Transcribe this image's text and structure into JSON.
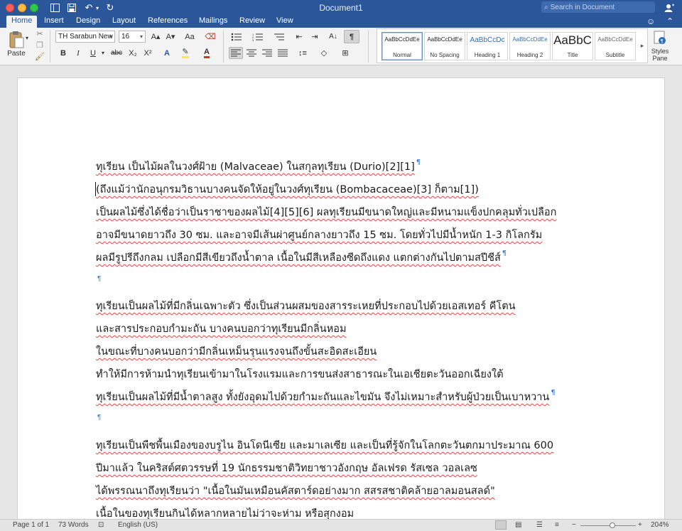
{
  "window": {
    "title": "Document1",
    "search_placeholder": "Search in Document"
  },
  "quick_access": {
    "sidebar_icon": "sidebar-icon",
    "save_icon": "save-icon",
    "undo_icon": "undo-icon",
    "redo_icon": "redo-icon",
    "undo_glyph": "↶",
    "redo_glyph": "↻"
  },
  "tabs": [
    "Home",
    "Insert",
    "Design",
    "Layout",
    "References",
    "Mailings",
    "Review",
    "View"
  ],
  "active_tab": "Home",
  "ribbon": {
    "paste_label": "Paste",
    "font_name": "TH Sarabun New",
    "font_size": "16",
    "grow_font": "A▴",
    "shrink_font": "A▾",
    "change_case": "Aa",
    "bold": "B",
    "italic": "I",
    "underline": "U",
    "strikethrough": "abc",
    "subscript": "X₂",
    "superscript": "X²",
    "text_effects": "A",
    "font_color": "A",
    "show_marks": "¶",
    "styles": [
      {
        "preview": "AaBbCcDdEe",
        "name": "Normal"
      },
      {
        "preview": "AaBbCcDdEe",
        "name": "No Spacing"
      },
      {
        "preview": "AaBbCcDc",
        "name": "Heading 1"
      },
      {
        "preview": "AaBbCcDdEe",
        "name": "Heading 2"
      },
      {
        "preview": "AaBbC",
        "name": "Title"
      },
      {
        "preview": "AaBbCcDdEe",
        "name": "Subtitle"
      }
    ],
    "styles_pane": "Styles\nPane",
    "styles_pane_line1": "Styles",
    "styles_pane_line2": "Pane"
  },
  "colors": {
    "brand_blue": "#2b579a",
    "spell_underline": "#e0483e",
    "pilcrow": "#3a7bd5",
    "highlight": "#ffeb3b",
    "font_color_bar": "#d93025"
  },
  "document": {
    "lines": [
      {
        "text": "ทุเรียน เป็นไม้ผลในวงศ์ฝ้าย (Malvaceae) ในสกุลทุเรียน (Durio)[2][1]",
        "mark": true
      },
      {
        "text": "(ถึงแม้ว่านักอนุกรมวิธานบางคนจัดให้อยู่ในวงศ์ทุเรียน (Bombacaceae)[3] ก็ตาม[1])",
        "mark": false
      },
      {
        "text": "เป็นผลไม้ซึ่งได้ชื่อว่าเป็นราชาของผลไม้[4][5][6] ผลทุเรียนมีขนาดใหญ่และมีหนามแข็งปกคลุมทั่วเปลือก",
        "mark": false
      },
      {
        "text": "อาจมีขนาดยาวถึง 30 ซม. และอาจมีเส้นผ่าศูนย์กลางยาวถึง 15 ซม. โดยทั่วไปมีน้ำหนัก 1-3 กิโลกรัม",
        "mark": false
      },
      {
        "text": "ผลมีรูปรีถึงกลม เปลือกมีสีเขียวถึงน้ำตาล เนื้อในมีสีเหลืองซีดถึงแดง แตกต่างกันไปตามสปีชีส์",
        "mark": true
      },
      {
        "text": "ทุเรียนเป็นผลไม้ที่มีกลิ่นเฉพาะตัว ซึ่งเป็นส่วนผสมของสารระเหยที่ประกอบไปด้วยเอสเทอร์ คีโตน",
        "mark": false
      },
      {
        "text": "และสารประกอบกำมะถัน บางคนบอกว่าทุเรียนมีกลิ่นหอม",
        "mark": false
      },
      {
        "text": "ในขณะที่บางคนบอกว่ามีกลิ่นเหม็นรุนแรงจนถึงขั้นสะอิดสะเอียน",
        "mark": false
      },
      {
        "text": "ทำให้มีการห้ามนำทุเรียนเข้ามาในโรงแรมและการขนส่งสาธารณะในเอเชียตะวันออกเฉียงใต้",
        "mark": false
      },
      {
        "text": "ทุเรียนเป็นผลไม้ที่มีน้ำตาลสูง ทั้งยังอุดมไปด้วยกำมะถันและไขมัน จึงไม่เหมาะสำหรับผู้ป่วยเป็นเบาหวาน",
        "mark": true
      },
      {
        "text": "ทุเรียนเป็นพืชพื้นเมืองของบรูไน อินโดนีเซีย และมาเลเซีย และเป็นที่รู้จักในโลกตะวันตกมาประมาณ 600",
        "mark": false
      },
      {
        "text": "ปีมาแล้ว ในคริสต์ศตวรรษที่ 19 นักธรรมชาติวิทยาชาวอังกฤษ อัลเฟรด รัสเซล วอลเลซ",
        "mark": false
      },
      {
        "text": "ได้พรรณนาถึงทุเรียนว่า \"เนื้อในมันเหมือนคัสตาร์ดอย่างมาก สสรสชาติคล้ายอาลมอนสลด์\"",
        "mark": false
      },
      {
        "text": "เนื้อในของทุเรียนกินได้หลากหลายไม่ว่าจะห่าม หรือสุกงอม",
        "mark": false
      }
    ],
    "pilcrow": "¶"
  },
  "status": {
    "page": "Page 1 of 1",
    "words": "73 Words",
    "language": "English (US)",
    "zoom": "204%",
    "zoom_minus": "−",
    "zoom_plus": "+"
  }
}
